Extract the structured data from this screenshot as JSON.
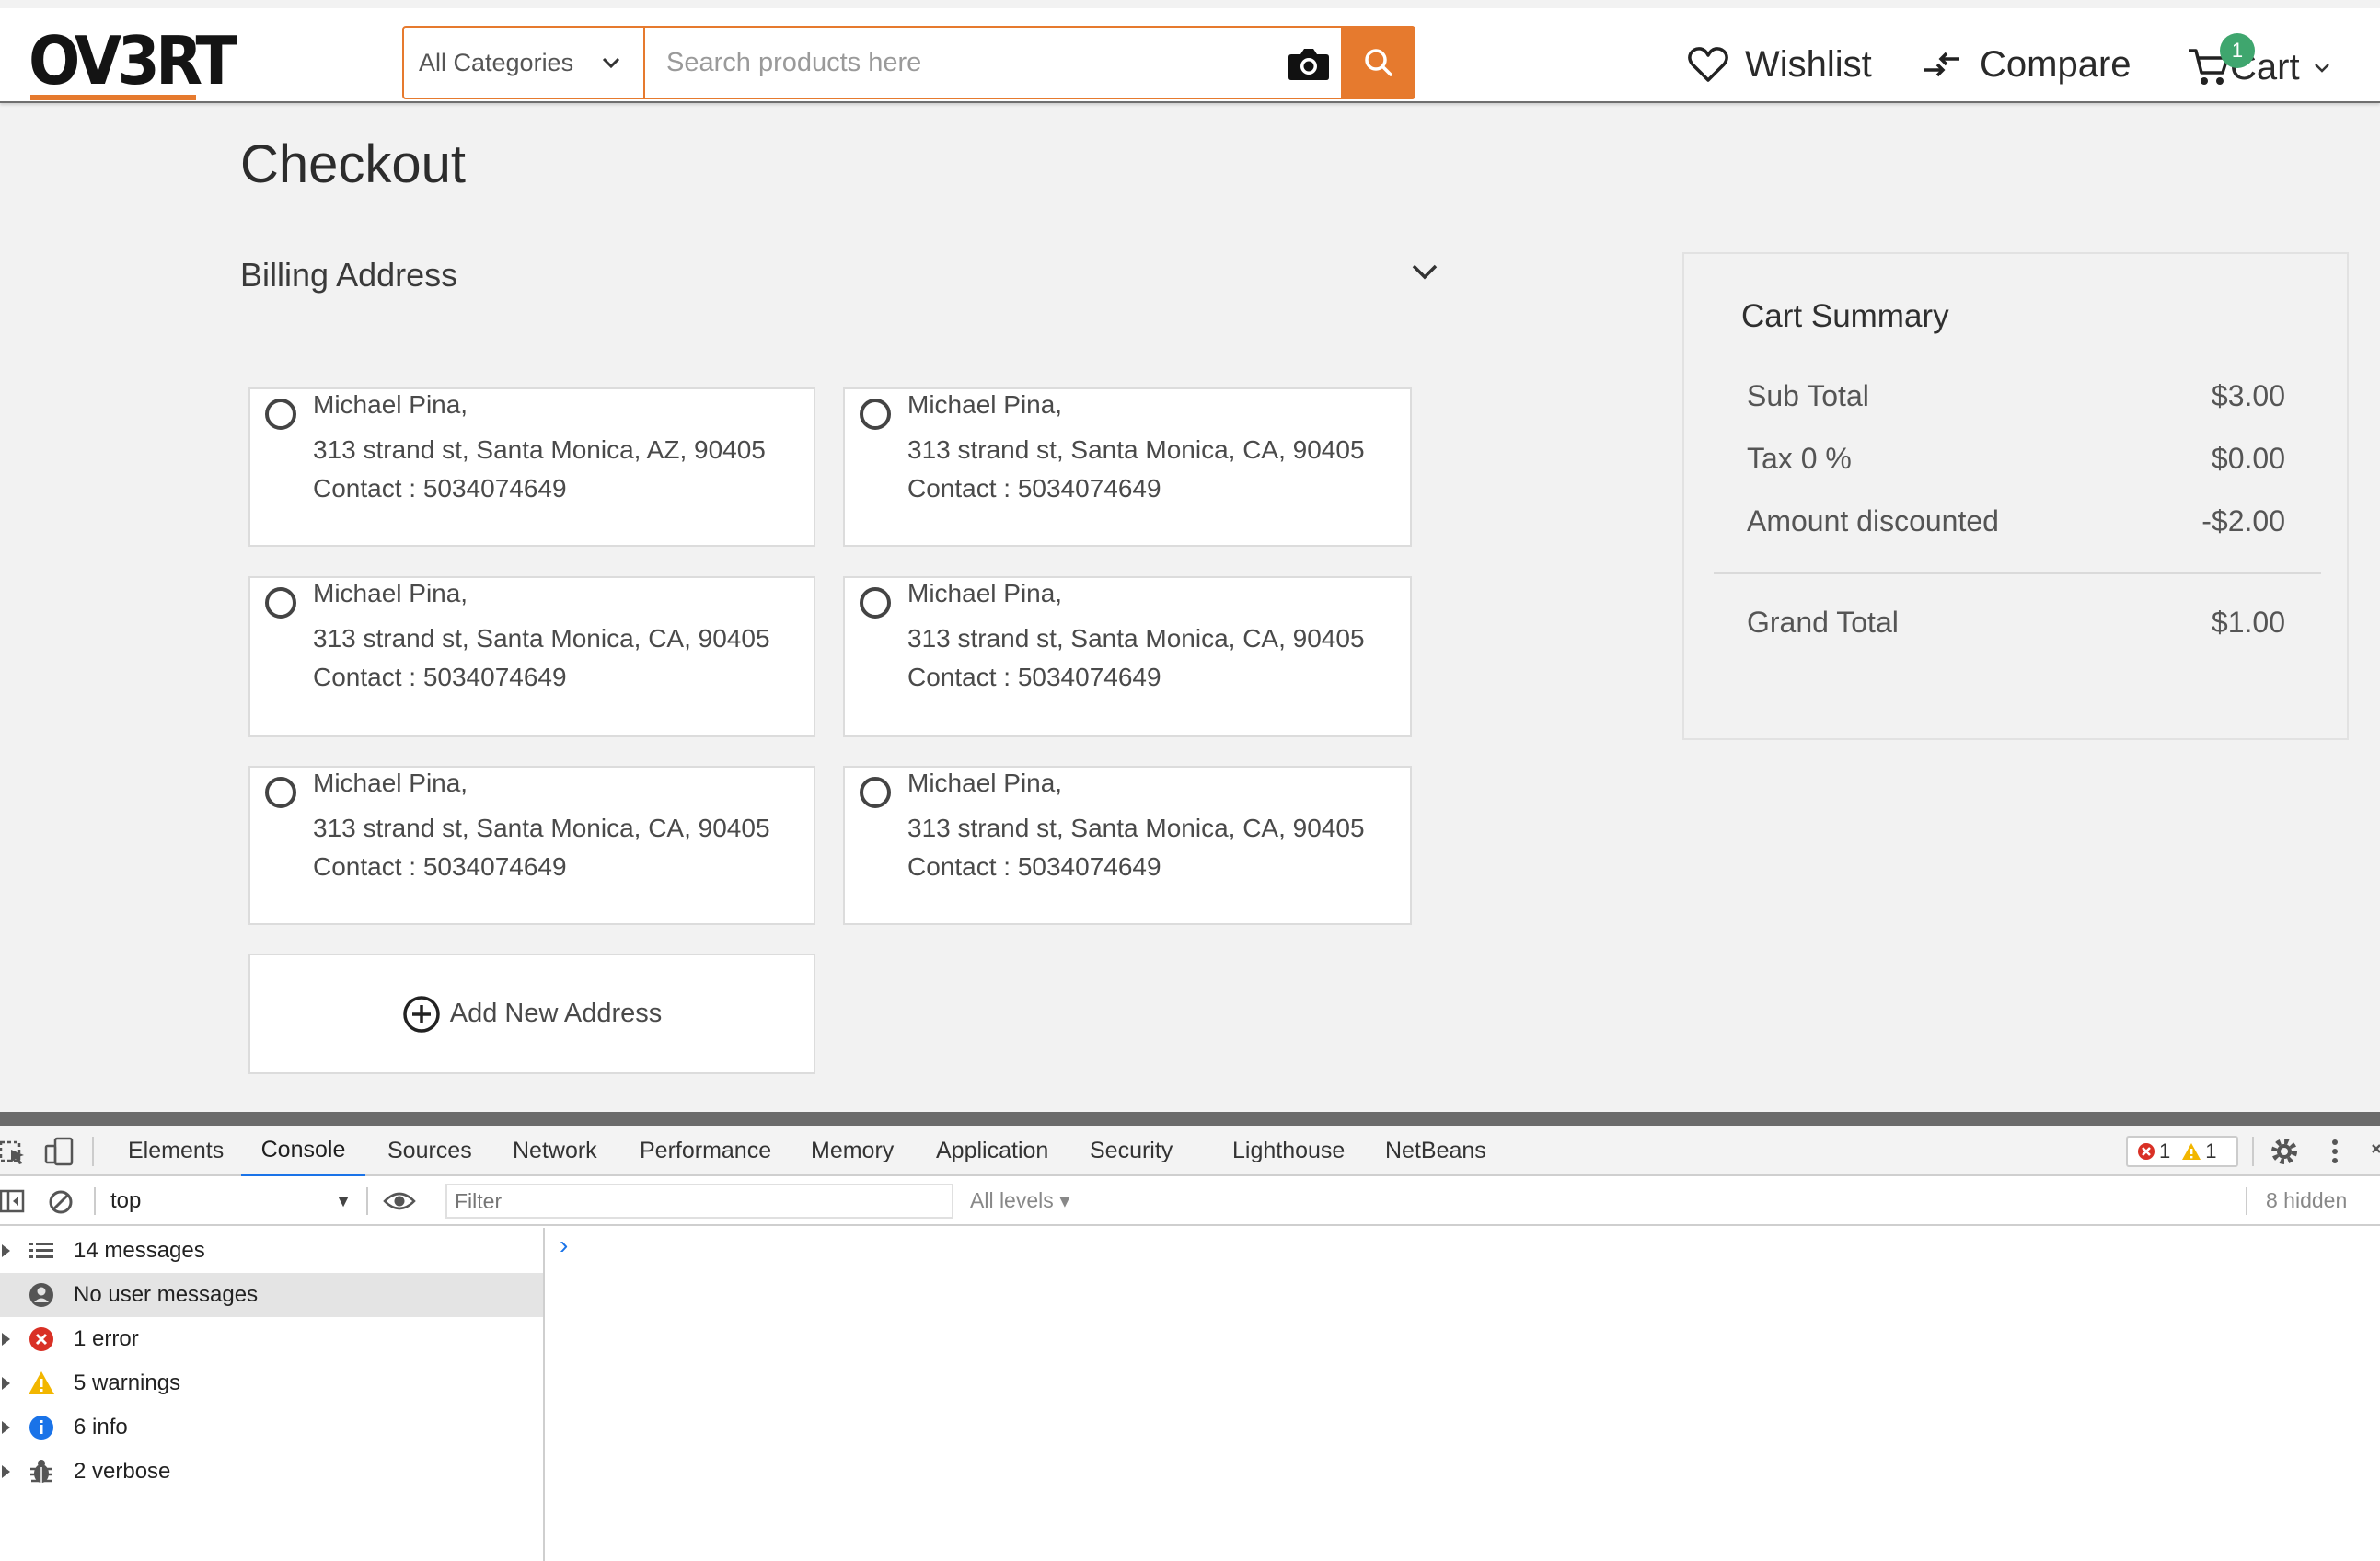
{
  "header": {
    "logo": "OV3RT",
    "category_select": "All Categories",
    "search_placeholder": "Search products here",
    "wishlist_label": "Wishlist",
    "compare_label": "Compare",
    "cart_label": "Cart",
    "cart_count": "1",
    "accent_color": "#e67a2e",
    "badge_color": "#3fa66e"
  },
  "main": {
    "title": "Checkout",
    "billing_title": "Billing Address",
    "addresses": [
      {
        "name": "Michael Pina,",
        "line": "313 strand st, Santa Monica, AZ, 90405",
        "contact": "Contact : 5034074649"
      },
      {
        "name": "Michael Pina,",
        "line": "313 strand st, Santa Monica, CA, 90405",
        "contact": "Contact : 5034074649"
      },
      {
        "name": "Michael Pina,",
        "line": "313 strand st, Santa Monica, CA, 90405",
        "contact": "Contact : 5034074649"
      },
      {
        "name": "Michael Pina,",
        "line": "313 strand st, Santa Monica, CA, 90405",
        "contact": "Contact : 5034074649"
      },
      {
        "name": "Michael Pina,",
        "line": "313 strand st, Santa Monica, CA, 90405",
        "contact": "Contact : 5034074649"
      },
      {
        "name": "Michael Pina,",
        "line": "313 strand st, Santa Monica, CA, 90405",
        "contact": "Contact : 5034074649"
      }
    ],
    "add_address_label": "Add New Address"
  },
  "summary": {
    "title": "Cart Summary",
    "rows": [
      {
        "label": "Sub Total",
        "value": "$3.00"
      },
      {
        "label": "Tax 0 %",
        "value": "$0.00"
      },
      {
        "label": "Amount discounted",
        "value": "-$2.00"
      }
    ],
    "grand_total_label": "Grand Total",
    "grand_total_value": "$1.00"
  },
  "devtools": {
    "tabs": [
      "Elements",
      "Console",
      "Sources",
      "Network",
      "Performance",
      "Memory",
      "Application",
      "Security",
      "Lighthouse",
      "NetBeans"
    ],
    "active_tab": "Console",
    "error_count": "1",
    "warning_count": "1",
    "context": "top",
    "filter_placeholder": "Filter",
    "levels": "All levels ▾",
    "hidden": "8 hidden",
    "sidebar": [
      {
        "label": "14 messages",
        "icon": "list-icon"
      },
      {
        "label": "No user messages",
        "icon": "user-icon"
      },
      {
        "label": "1 error",
        "icon": "error-icon"
      },
      {
        "label": "5 warnings",
        "icon": "warning-icon"
      },
      {
        "label": "6 info",
        "icon": "info-icon"
      },
      {
        "label": "2 verbose",
        "icon": "bug-icon"
      }
    ],
    "prompt": "›"
  }
}
